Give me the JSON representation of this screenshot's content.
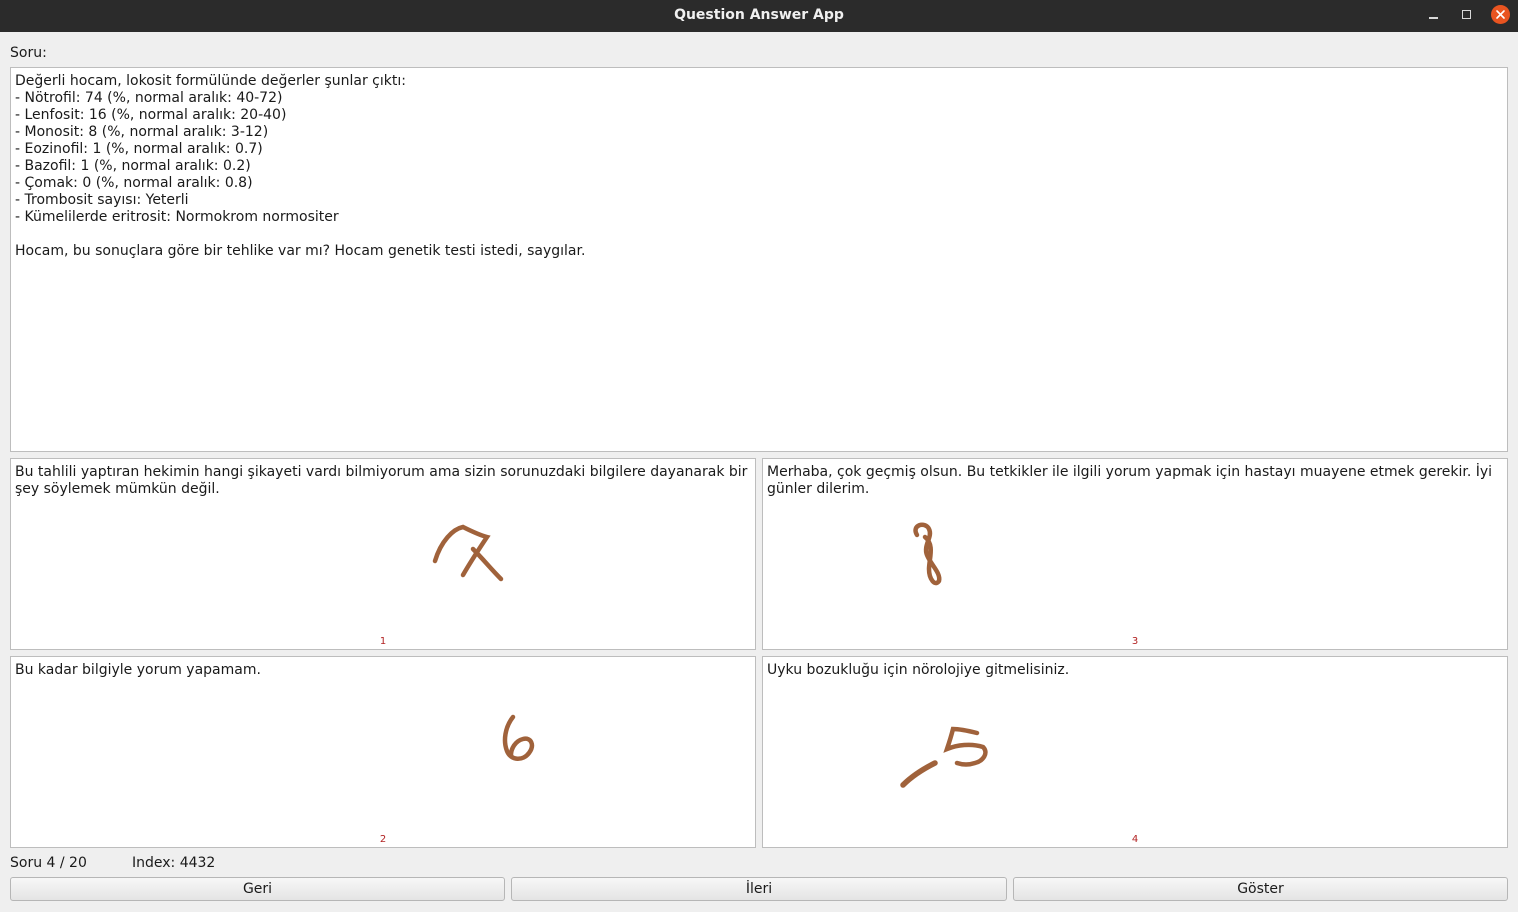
{
  "window": {
    "title": "Question Answer App"
  },
  "question": {
    "label": "Soru:",
    "text": "Değerli hocam, lokosit formülünde değerler şunlar çıktı:\n- Nötrofil: 74 (%, normal aralık: 40-72)\n- Lenfosit: 16 (%, normal aralık: 20-40)\n- Monosit: 8 (%, normal aralık: 3-12)\n- Eozinofil: 1 (%, normal aralık: 0.7)\n- Bazofil: 1 (%, normal aralık: 0.2)\n- Çomak: 0 (%, normal aralık: 0.8)\n- Trombosit sayısı: Yeterli\n- Kümelilerde eritrosit: Normokrom normositer\n\nHocam, bu sonuçlara göre bir tehlike var mı? Hocam genetik testi istedi, saygılar."
  },
  "answers": [
    {
      "text": "Bu tahlili yaptıran hekimin hangi şikayeti vardı bilmiyorum ama sizin sorunuzdaki bilgilere dayanarak bir şey söylemek mümkün değil.",
      "number": "1",
      "mark": "7"
    },
    {
      "text": "Merhaba, çok geçmiş olsun. Bu tetkikler ile ilgili yorum yapmak için hastayı muayene etmek gerekir. İyi günler dilerim.",
      "number": "3",
      "mark": "8"
    },
    {
      "text": "Bu kadar bilgiyle yorum yapamam.",
      "number": "2",
      "mark": "6"
    },
    {
      "text": "Uyku bozukluğu için nörolojiye gitmelisiniz.",
      "number": "4",
      "mark": "-5"
    }
  ],
  "status": {
    "progress": "Soru 4 / 20",
    "index": "Index: 4432"
  },
  "buttons": {
    "back": "Geri",
    "next": "İleri",
    "show": "Göster"
  },
  "colors": {
    "handwriting": "#a0623b",
    "number": "#b22222",
    "close_button": "#e95420"
  }
}
